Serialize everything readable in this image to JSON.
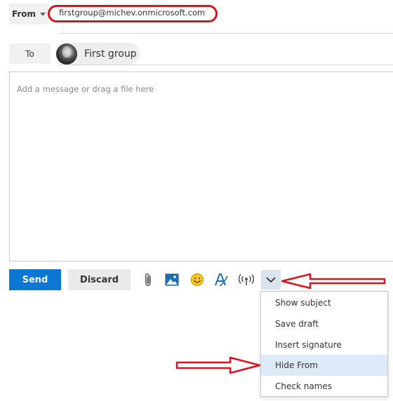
{
  "compose": {
    "from_label": "From",
    "from_email": "firstgroup@michev.onmicrosoft.com",
    "to_label": "To",
    "recipient": "First group",
    "message_placeholder": "Add a message or drag a file here"
  },
  "actions": {
    "send_label": "Send",
    "discard_label": "Discard",
    "icons": [
      "paperclip-icon",
      "image-icon",
      "emoji-icon",
      "text-format-icon",
      "broadcast-icon",
      "chevron-down-icon"
    ]
  },
  "menu": {
    "items": [
      "Show subject",
      "Save draft",
      "Insert signature",
      "Hide From",
      "Check names"
    ],
    "highlighted_index": 3
  },
  "colors": {
    "accent": "#0a78d4",
    "annotation": "#e0101c",
    "menu_highlight": "#dcebf7"
  }
}
